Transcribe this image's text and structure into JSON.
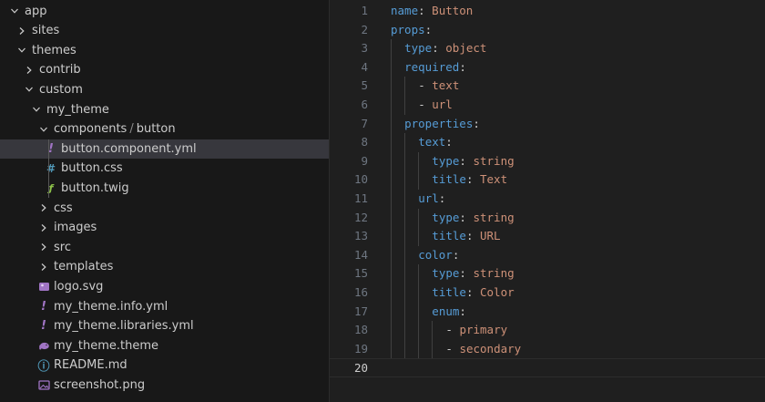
{
  "explorer": {
    "items": [
      {
        "label": "app",
        "level": 0,
        "kind": "folder-open"
      },
      {
        "label": "sites",
        "level": 1,
        "kind": "folder-closed"
      },
      {
        "label": "themes",
        "level": 1,
        "kind": "folder-open"
      },
      {
        "label": "contrib",
        "level": 2,
        "kind": "folder-closed"
      },
      {
        "label": "custom",
        "level": 2,
        "kind": "folder-open"
      },
      {
        "label": "my_theme",
        "level": 3,
        "kind": "folder-open"
      },
      {
        "label": "components",
        "label2": "button",
        "sep": "/",
        "level": 4,
        "kind": "folder-open"
      },
      {
        "label": "button.component.yml",
        "level": 5,
        "kind": "file",
        "icon": "exclamation-icon",
        "selected": true
      },
      {
        "label": "button.css",
        "level": 5,
        "kind": "file",
        "icon": "hash-icon"
      },
      {
        "label": "button.twig",
        "level": 5,
        "kind": "file",
        "icon": "twig-icon"
      },
      {
        "label": "css",
        "level": 4,
        "kind": "folder-closed"
      },
      {
        "label": "images",
        "level": 4,
        "kind": "folder-closed"
      },
      {
        "label": "src",
        "level": 4,
        "kind": "folder-closed"
      },
      {
        "label": "templates",
        "level": 4,
        "kind": "folder-closed"
      },
      {
        "label": "logo.svg",
        "level": 4,
        "kind": "file",
        "icon": "svg-image-icon"
      },
      {
        "label": "my_theme.info.yml",
        "level": 4,
        "kind": "file",
        "icon": "exclamation-icon"
      },
      {
        "label": "my_theme.libraries.yml",
        "level": 4,
        "kind": "file",
        "icon": "exclamation-icon"
      },
      {
        "label": "my_theme.theme",
        "level": 4,
        "kind": "file",
        "icon": "elephant-icon"
      },
      {
        "label": "README.md",
        "level": 4,
        "kind": "file",
        "icon": "info-icon"
      },
      {
        "label": "screenshot.png",
        "level": 4,
        "kind": "file",
        "icon": "image-icon"
      }
    ]
  },
  "editor": {
    "current_line": 20,
    "lines": [
      {
        "n": "1",
        "indent": 0,
        "tokens": [
          {
            "t": "name",
            "c": "k"
          },
          {
            "t": ": ",
            "c": "p"
          },
          {
            "t": "Button",
            "c": "v"
          }
        ]
      },
      {
        "n": "2",
        "indent": 0,
        "tokens": [
          {
            "t": "props",
            "c": "k"
          },
          {
            "t": ":",
            "c": "p"
          }
        ]
      },
      {
        "n": "3",
        "indent": 1,
        "tokens": [
          {
            "t": "type",
            "c": "k"
          },
          {
            "t": ": ",
            "c": "p"
          },
          {
            "t": "object",
            "c": "v"
          }
        ]
      },
      {
        "n": "4",
        "indent": 1,
        "tokens": [
          {
            "t": "required",
            "c": "k"
          },
          {
            "t": ":",
            "c": "p"
          }
        ]
      },
      {
        "n": "5",
        "indent": 2,
        "tokens": [
          {
            "t": "- ",
            "c": "dash"
          },
          {
            "t": "text",
            "c": "v"
          }
        ]
      },
      {
        "n": "6",
        "indent": 2,
        "tokens": [
          {
            "t": "- ",
            "c": "dash"
          },
          {
            "t": "url",
            "c": "v"
          }
        ]
      },
      {
        "n": "7",
        "indent": 1,
        "tokens": [
          {
            "t": "properties",
            "c": "k"
          },
          {
            "t": ":",
            "c": "p"
          }
        ]
      },
      {
        "n": "8",
        "indent": 2,
        "tokens": [
          {
            "t": "text",
            "c": "k"
          },
          {
            "t": ":",
            "c": "p"
          }
        ]
      },
      {
        "n": "9",
        "indent": 3,
        "tokens": [
          {
            "t": "type",
            "c": "k"
          },
          {
            "t": ": ",
            "c": "p"
          },
          {
            "t": "string",
            "c": "v"
          }
        ]
      },
      {
        "n": "10",
        "indent": 3,
        "tokens": [
          {
            "t": "title",
            "c": "k"
          },
          {
            "t": ": ",
            "c": "p"
          },
          {
            "t": "Text",
            "c": "v"
          }
        ]
      },
      {
        "n": "11",
        "indent": 2,
        "tokens": [
          {
            "t": "url",
            "c": "k"
          },
          {
            "t": ":",
            "c": "p"
          }
        ]
      },
      {
        "n": "12",
        "indent": 3,
        "tokens": [
          {
            "t": "type",
            "c": "k"
          },
          {
            "t": ": ",
            "c": "p"
          },
          {
            "t": "string",
            "c": "v"
          }
        ]
      },
      {
        "n": "13",
        "indent": 3,
        "tokens": [
          {
            "t": "title",
            "c": "k"
          },
          {
            "t": ": ",
            "c": "p"
          },
          {
            "t": "URL",
            "c": "v"
          }
        ]
      },
      {
        "n": "14",
        "indent": 2,
        "tokens": [
          {
            "t": "color",
            "c": "k"
          },
          {
            "t": ":",
            "c": "p"
          }
        ]
      },
      {
        "n": "15",
        "indent": 3,
        "tokens": [
          {
            "t": "type",
            "c": "k"
          },
          {
            "t": ": ",
            "c": "p"
          },
          {
            "t": "string",
            "c": "v"
          }
        ]
      },
      {
        "n": "16",
        "indent": 3,
        "tokens": [
          {
            "t": "title",
            "c": "k"
          },
          {
            "t": ": ",
            "c": "p"
          },
          {
            "t": "Color",
            "c": "v"
          }
        ]
      },
      {
        "n": "17",
        "indent": 3,
        "tokens": [
          {
            "t": "enum",
            "c": "k"
          },
          {
            "t": ":",
            "c": "p"
          }
        ]
      },
      {
        "n": "18",
        "indent": 4,
        "tokens": [
          {
            "t": "- ",
            "c": "dash"
          },
          {
            "t": "primary",
            "c": "v"
          }
        ]
      },
      {
        "n": "19",
        "indent": 4,
        "tokens": [
          {
            "t": "- ",
            "c": "dash"
          },
          {
            "t": "secondary",
            "c": "v"
          }
        ]
      },
      {
        "n": "20",
        "indent": 0,
        "tokens": []
      }
    ]
  },
  "colors": {
    "key": "#569cd6",
    "value": "#ce9178",
    "selected_row": "#37373d",
    "yml_icon": "#a074c4",
    "css_icon": "#519aba",
    "twig_icon": "#8dc149"
  }
}
